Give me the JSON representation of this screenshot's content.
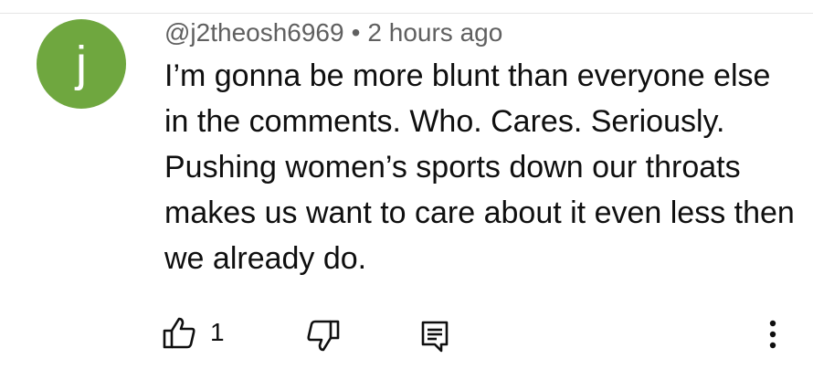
{
  "comment": {
    "avatar_letter": "j",
    "avatar_color": "#6fa73f",
    "author": "@j2theosh6969",
    "separator": "•",
    "timestamp": "2 hours ago",
    "text": "I’m gonna be more blunt than everyone else in the comments. Who. Cares. Seriously. Pushing women’s sports down our throats makes us want to care about it even less then we already do.",
    "like_count": "1"
  },
  "icons": {
    "like": "thumbs-up-icon",
    "dislike": "thumbs-down-icon",
    "reply": "reply-comment-icon",
    "more": "more-vertical-icon"
  }
}
